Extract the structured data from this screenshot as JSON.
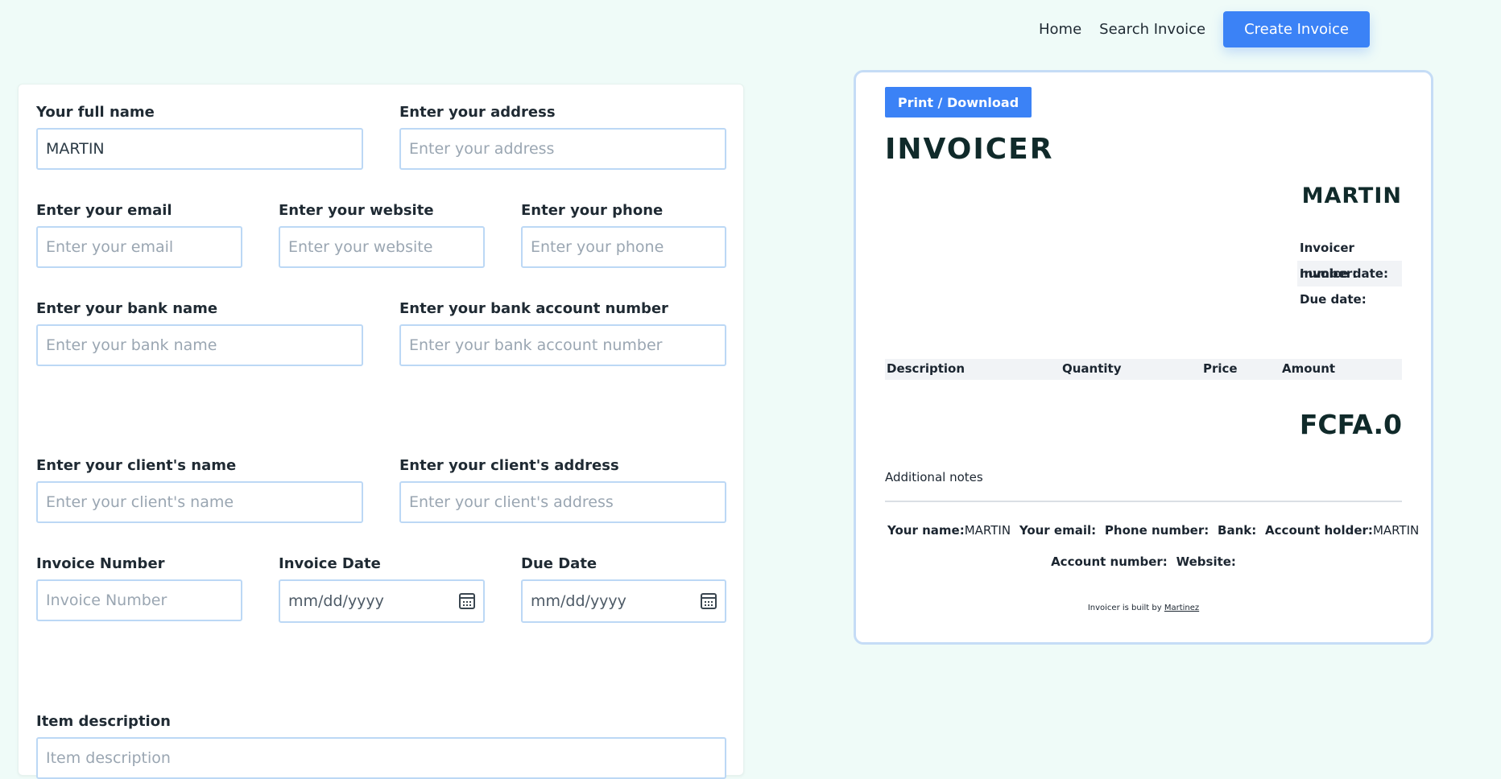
{
  "nav": {
    "home": "Home",
    "search": "Search Invoice",
    "create": "Create Invoice"
  },
  "form": {
    "full_name": {
      "label": "Your full name",
      "value": "MARTIN",
      "placeholder": ""
    },
    "address": {
      "label": "Enter your address",
      "value": "",
      "placeholder": "Enter your address"
    },
    "email": {
      "label": "Enter your email",
      "value": "",
      "placeholder": "Enter your email"
    },
    "website": {
      "label": "Enter your website",
      "value": "",
      "placeholder": "Enter your website"
    },
    "phone": {
      "label": "Enter your phone",
      "value": "",
      "placeholder": "Enter your phone"
    },
    "bank_name": {
      "label": "Enter your bank name",
      "value": "",
      "placeholder": "Enter your bank name"
    },
    "bank_account": {
      "label": "Enter your bank account number",
      "value": "",
      "placeholder": "Enter your bank account number"
    },
    "client_name": {
      "label": "Enter your client's name",
      "value": "",
      "placeholder": "Enter your client's name"
    },
    "client_address": {
      "label": "Enter your client's address",
      "value": "",
      "placeholder": "Enter your client's address"
    },
    "invoice_number": {
      "label": "Invoice Number",
      "value": "",
      "placeholder": "Invoice Number"
    },
    "invoice_date": {
      "label": "Invoice Date",
      "display": "mm/dd/yyyy"
    },
    "due_date": {
      "label": "Due Date",
      "display": "mm/dd/yyyy"
    },
    "item_description": {
      "label": "Item description",
      "value": "",
      "placeholder": "Item description"
    }
  },
  "preview": {
    "print_button": "Print / Download",
    "title": "INVOICER",
    "name": "MARTIN",
    "meta": {
      "invoice_number": "Invoicer number:",
      "invoice_date": "Invoice date:",
      "due_date": "Due date:"
    },
    "table_headers": {
      "description": "Description",
      "quantity": "Quantity",
      "price": "Price",
      "amount": "Amount"
    },
    "total": "FCFA.0",
    "notes_label": "Additional notes",
    "footer": {
      "your_name_label": "Your name:",
      "your_name_value": "MARTIN",
      "email_label": "Your email:",
      "phone_label": "Phone number:",
      "bank_label": "Bank:",
      "holder_label": "Account holder:",
      "holder_value": "MARTIN",
      "account_number_label": "Account number:",
      "website_label": "Website:"
    },
    "credit_text": "Invoicer is built by",
    "credit_link": "Martinez"
  },
  "colors": {
    "accent": "#3b82f6",
    "page_bg": "#effbf8",
    "input_border": "#bcd8f5"
  }
}
